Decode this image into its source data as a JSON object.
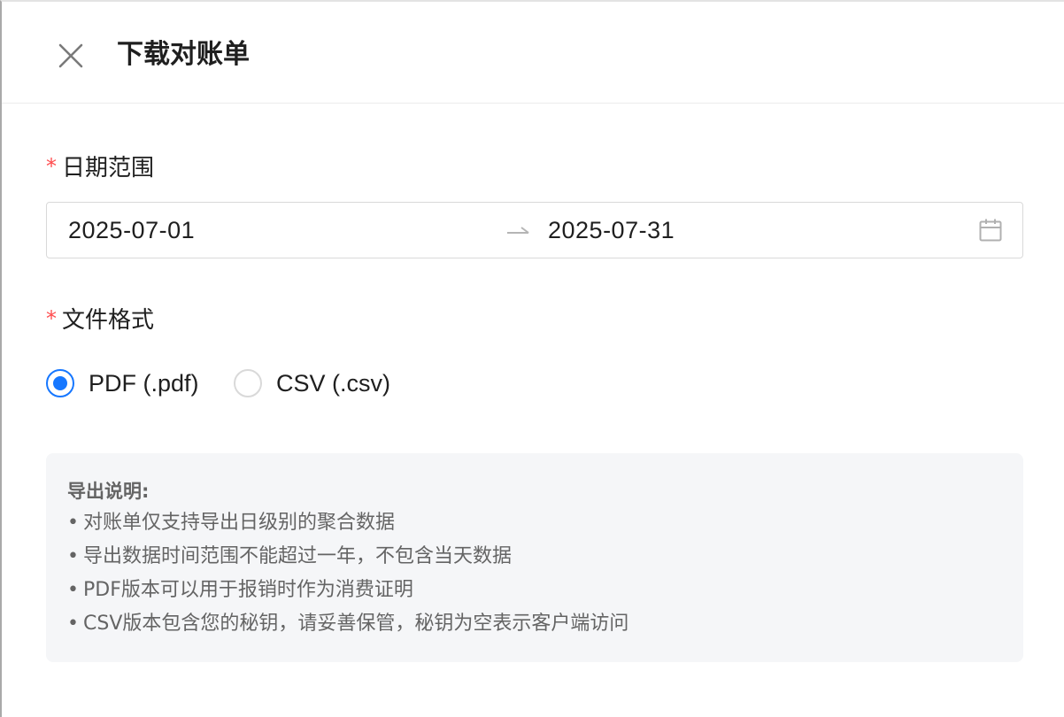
{
  "header": {
    "title": "下载对账单",
    "close_icon": "close-icon"
  },
  "date_range": {
    "required_mark": "*",
    "label": "日期范围",
    "start": "2025-07-01",
    "end": "2025-07-31",
    "separator_icon": "arrow-right-icon",
    "calendar_icon": "calendar-icon"
  },
  "file_format": {
    "required_mark": "*",
    "label": "文件格式",
    "options": [
      {
        "label": "PDF (.pdf)",
        "checked": true
      },
      {
        "label": "CSV (.csv)",
        "checked": false
      }
    ]
  },
  "notice": {
    "title": "导出说明:",
    "bullet": "•",
    "items": [
      "对账单仅支持导出日级别的聚合数据",
      "导出数据时间范围不能超过一年，不包含当天数据",
      "PDF版本可以用于报销时作为消费证明",
      "CSV版本包含您的秘钥，请妥善保管，秘钥为空表示客户端访问"
    ]
  },
  "colors": {
    "accent": "#1677ff",
    "required": "#ff4d4f",
    "notice_bg": "#f5f6f8"
  }
}
